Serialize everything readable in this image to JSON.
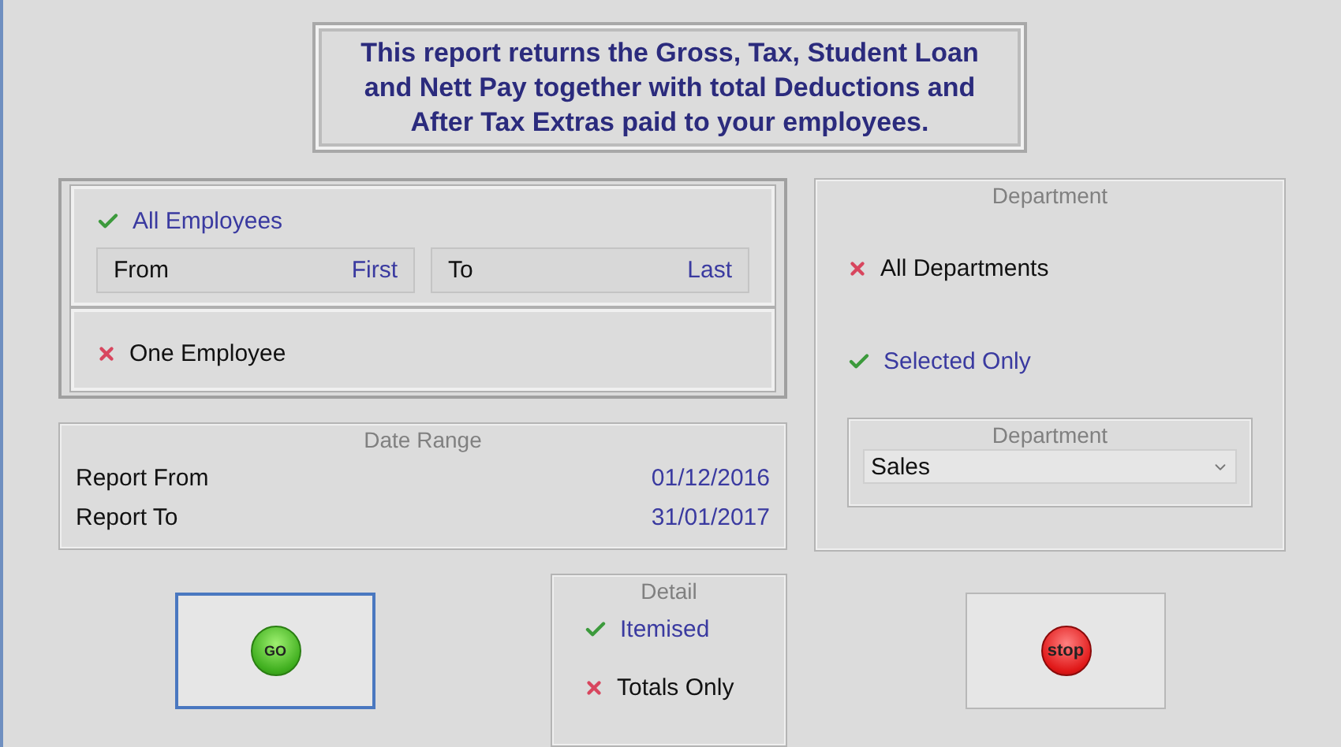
{
  "header": {
    "text": "This report returns the Gross, Tax, Student Loan and Nett Pay together with total Deductions and After Tax Extras paid to your employees."
  },
  "employees": {
    "options": [
      {
        "label": "All Employees",
        "selected": true,
        "range": [
          {
            "label": "From",
            "value": "First"
          },
          {
            "label": "To",
            "value": "Last"
          }
        ]
      },
      {
        "label": "One Employee",
        "selected": false
      }
    ]
  },
  "date_range": {
    "title": "Date Range",
    "rows": [
      {
        "label": "Report From",
        "value": "01/12/2016"
      },
      {
        "label": "Report To",
        "value": "31/01/2017"
      }
    ]
  },
  "department": {
    "title": "Department",
    "options": [
      {
        "label": "All Departments",
        "selected": false
      },
      {
        "label": "Selected Only",
        "selected": true
      }
    ],
    "select": {
      "title": "Department",
      "value": "Sales"
    }
  },
  "detail": {
    "title": "Detail",
    "options": [
      {
        "label": "Itemised",
        "selected": true
      },
      {
        "label": "Totals Only",
        "selected": false
      }
    ]
  },
  "buttons": [
    {
      "kind": "go",
      "label": "GO",
      "focused": true
    },
    {
      "kind": "stop",
      "label": "stop",
      "focused": false
    }
  ]
}
